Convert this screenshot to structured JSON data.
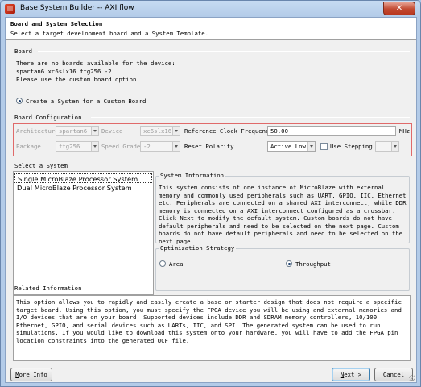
{
  "window": {
    "title": "Base System Builder -- AXI flow",
    "close_glyph": "✕"
  },
  "header": {
    "title": "Board and System Selection",
    "subtitle": "Select a target development board and a System Template."
  },
  "board": {
    "section_label": "Board",
    "message_line1": "There are no boards available for the device:",
    "message_line2": "spartan6 xc6slx16 ftg256 -2",
    "message_line3": "Please use the custom board option.",
    "radio_custom_label": "Create a System for a Custom Board",
    "radio_custom_selected": true
  },
  "board_config": {
    "section_label": "Board Configuration",
    "architecture_label": "Architecture",
    "architecture_value": "spartan6",
    "device_label": "Device",
    "device_value": "xc6slx16",
    "ref_clock_label": "Reference Clock Frequency",
    "ref_clock_value": "50.00",
    "ref_clock_unit": "MHz",
    "package_label": "Package",
    "package_value": "ftg256",
    "speed_grade_label": "Speed Grade",
    "speed_grade_value": "-2",
    "reset_polarity_label": "Reset Polarity",
    "reset_polarity_value": "Active Low",
    "use_stepping_label": "Use Stepping",
    "use_stepping_checked": false,
    "stepping_value": ""
  },
  "system": {
    "section_label": "Select a System",
    "items": [
      {
        "label": "Single MicroBlaze Processor System",
        "selected": true
      },
      {
        "label": "Dual MicroBlaze Processor System",
        "selected": false
      }
    ]
  },
  "system_info": {
    "title": "System Information",
    "text": "This system consists of one instance of MicroBlaze with external memory and commonly used peripherals such as UART, GPIO, IIC, Ethernet etc. Peripherals are connected on a shared AXI interconnect, while DDR memory is connected on a AXI interconnect configured as a crossbar. Click Next to modify the default system. Custom boards do not have default peripherals and need to be selected on the next page. Custom boards do not have default peripherals and need to be selected on the next page."
  },
  "optimization": {
    "title": "Optimization Strategy",
    "area_label": "Area",
    "throughput_label": "Throughput",
    "selected": "Throughput"
  },
  "related": {
    "title": "Related Information",
    "text": "This option allows you to rapidly and easily create a base or starter design that does not require a specific target board. Using this option, you must specify the FPGA device you will be using and external memories and I/O devices that are on your board. Supported devices include DDR and SDRAM memory controllers, 10/100 Ethernet, GPIO, and serial devices such as UARTs, IIC, and SPI. The generated system can be used to run simulations. If you would like to download this system onto your hardware, you will have to add the FPGA pin location constraints into the generated UCF file."
  },
  "buttons": {
    "more_info_mn": "M",
    "more_info_rest": "ore Info",
    "next_mn": "N",
    "next_rest": "ext >",
    "cancel": "Cancel"
  }
}
